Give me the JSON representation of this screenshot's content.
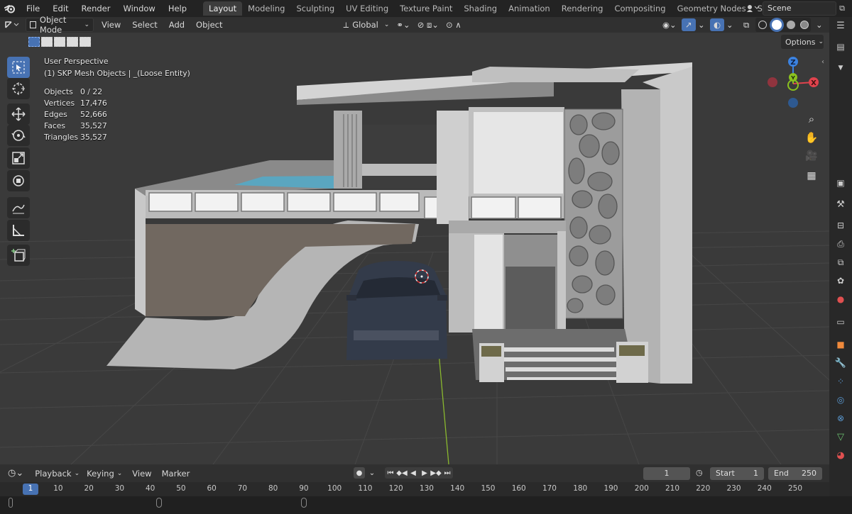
{
  "menu": {
    "items": [
      "File",
      "Edit",
      "Render",
      "Window",
      "Help"
    ]
  },
  "workspaces": {
    "tabs": [
      "Layout",
      "Modeling",
      "Sculpting",
      "UV Editing",
      "Texture Paint",
      "Shading",
      "Animation",
      "Rendering",
      "Compositing",
      "Geometry Nodes",
      "Scripting"
    ],
    "active": "Layout",
    "add": "+"
  },
  "scene": {
    "name": "Scene"
  },
  "viewport_header": {
    "mode": "Object Mode",
    "menus": [
      "View",
      "Select",
      "Add",
      "Object"
    ],
    "orientation": "Global",
    "options": "Options"
  },
  "overlay_info": {
    "perspective": "User Perspective",
    "collection": "(1) SKP Mesh Objects | _(Loose Entity)",
    "stats": [
      {
        "label": "Objects",
        "value": "0 / 22"
      },
      {
        "label": "Vertices",
        "value": "17,476"
      },
      {
        "label": "Edges",
        "value": "52,666"
      },
      {
        "label": "Faces",
        "value": "35,527"
      },
      {
        "label": "Triangles",
        "value": "35,527"
      }
    ]
  },
  "gizmo": {
    "z": "Z",
    "y": "Y",
    "x": "X"
  },
  "timeline": {
    "menus": [
      "Playback",
      "Keying",
      "View",
      "Marker"
    ],
    "current_frame": "1",
    "start_label": "Start",
    "start_value": "1",
    "end_label": "End",
    "end_value": "250",
    "ruler": [
      "1",
      "10",
      "20",
      "30",
      "40",
      "50",
      "60",
      "70",
      "80",
      "90",
      "100",
      "110",
      "120",
      "130",
      "140",
      "150",
      "160",
      "170",
      "180",
      "190",
      "200",
      "210",
      "220",
      "230",
      "240",
      "250"
    ]
  },
  "colors": {
    "accent": "#4772b3",
    "axis_x": "#e0434d",
    "axis_y": "#8ac21f",
    "axis_z": "#3b82e0"
  }
}
